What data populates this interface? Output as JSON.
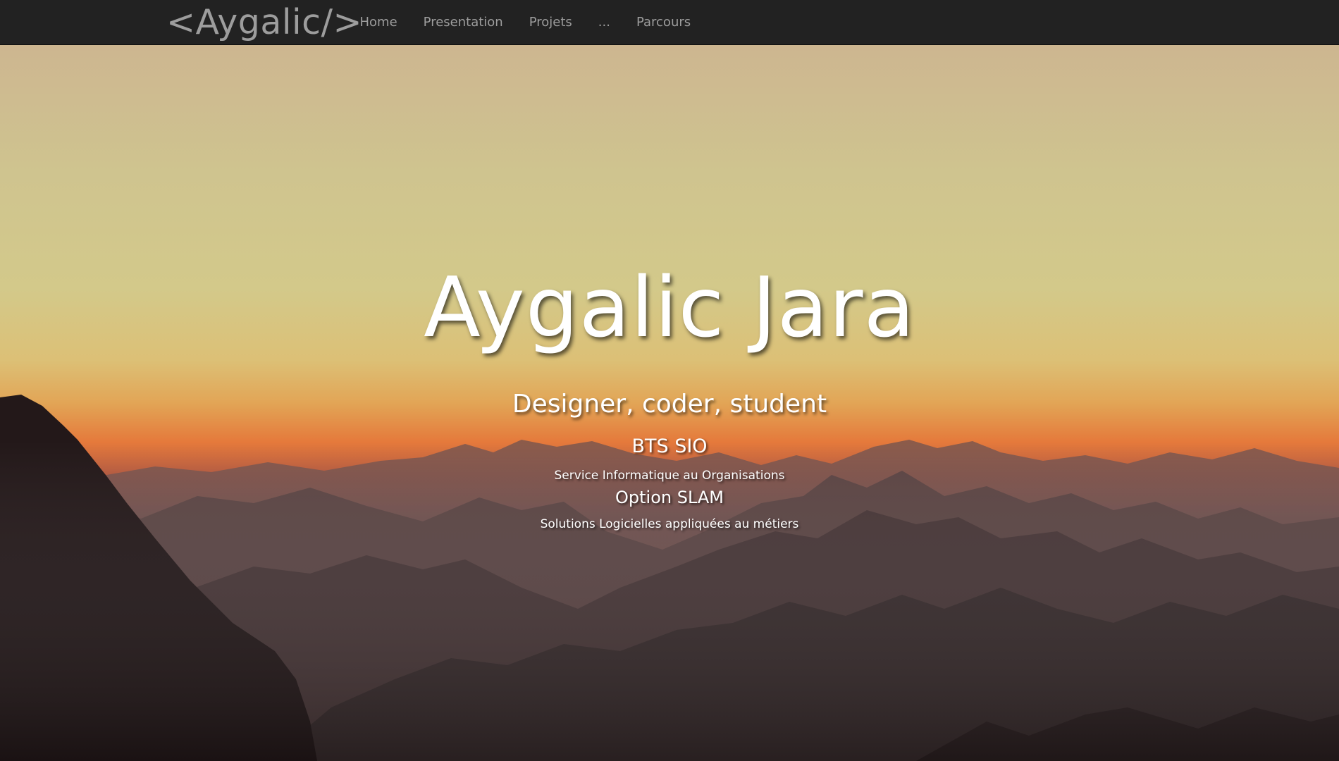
{
  "navbar": {
    "brand": "<Aygalic/>",
    "items": [
      {
        "label": "Home"
      },
      {
        "label": "Presentation"
      },
      {
        "label": "Projets"
      },
      {
        "label": "..."
      },
      {
        "label": "Parcours"
      }
    ]
  },
  "hero": {
    "title": "Aygalic Jara",
    "subtitle": "Designer, coder, student",
    "degree": "BTS SIO",
    "degree_full": "Service Informatique au Organisations",
    "option": "Option SLAM",
    "option_full": "Solutions Logicielles appliquées au métiers"
  },
  "colors": {
    "navbar_bg": "#222222",
    "nav_text": "#9d9d9d",
    "hero_text": "#ffffff",
    "sky_top": "#cbb894",
    "sky_mid": "#d0cb8e",
    "horizon_orange": "#e0783a",
    "mountain_dark": "#2b2022"
  }
}
